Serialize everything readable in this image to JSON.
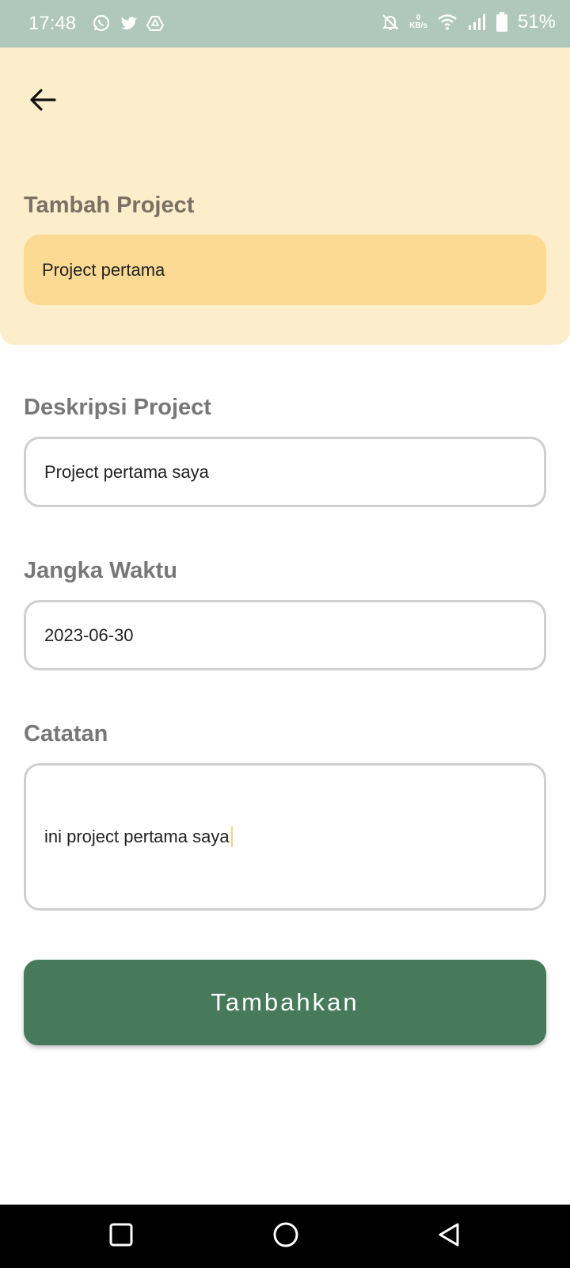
{
  "status_bar": {
    "time": "17:48",
    "left_icons": [
      "whatsapp-icon",
      "twitter-icon",
      "drive-icon"
    ],
    "data_rate_value": "0",
    "data_rate_unit": "KB/s",
    "battery_percent": "51%"
  },
  "header": {
    "title": "Tambah Project",
    "project_name_value": "Project pertama"
  },
  "form": {
    "description_label": "Deskripsi Project",
    "description_value": "Project pertama saya",
    "deadline_label": "Jangka Waktu",
    "deadline_value": "2023-06-30",
    "notes_label": "Catatan",
    "notes_value": "ini project pertama saya",
    "submit_label": "Tambahkan"
  },
  "colors": {
    "status_bar": "#b0c8bc",
    "header_bg": "#fdeecb",
    "filled_field": "#fcda94",
    "primary_button": "#467a5b"
  }
}
